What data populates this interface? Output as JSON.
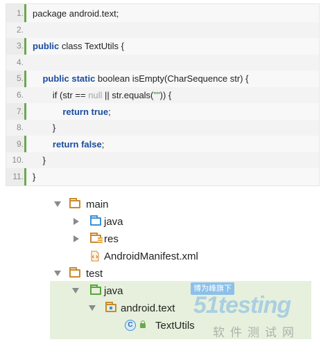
{
  "code": {
    "lines": [
      {
        "num": "1.",
        "segments": [
          {
            "t": "package android.text;",
            "c": ""
          }
        ]
      },
      {
        "num": "2.",
        "segments": []
      },
      {
        "num": "3.",
        "segments": [
          {
            "t": "public",
            "c": "kw"
          },
          {
            "t": " class TextUtils {",
            "c": ""
          }
        ]
      },
      {
        "num": "4.",
        "segments": []
      },
      {
        "num": "5.",
        "segments": [
          {
            "t": "    ",
            "c": ""
          },
          {
            "t": "public static",
            "c": "kw"
          },
          {
            "t": " boolean isEmpty(CharSequence str) {",
            "c": ""
          }
        ]
      },
      {
        "num": "6.",
        "segments": [
          {
            "t": "        if (str == ",
            "c": ""
          },
          {
            "t": "null",
            "c": "lit"
          },
          {
            "t": " || str.equals(",
            "c": ""
          },
          {
            "t": "\"\"",
            "c": "str"
          },
          {
            "t": ")) {",
            "c": ""
          }
        ]
      },
      {
        "num": "7.",
        "segments": [
          {
            "t": "            ",
            "c": ""
          },
          {
            "t": "return true",
            "c": "kw"
          },
          {
            "t": ";",
            "c": ""
          }
        ]
      },
      {
        "num": "8.",
        "segments": [
          {
            "t": "        }",
            "c": ""
          }
        ]
      },
      {
        "num": "9.",
        "segments": [
          {
            "t": "        ",
            "c": ""
          },
          {
            "t": "return false",
            "c": "kw"
          },
          {
            "t": ";",
            "c": ""
          }
        ]
      },
      {
        "num": "10.",
        "segments": [
          {
            "t": "    }",
            "c": ""
          }
        ]
      },
      {
        "num": "11.",
        "segments": [
          {
            "t": "}",
            "c": ""
          }
        ]
      }
    ]
  },
  "tree": {
    "main": {
      "label": "main",
      "icon": "folder-icon",
      "expanded": true
    },
    "java_main": {
      "label": "java",
      "icon": "source-folder-icon",
      "expanded": false
    },
    "res": {
      "label": "res",
      "icon": "resource-folder-icon",
      "expanded": false
    },
    "manifest": {
      "label": "AndroidManifest.xml",
      "icon": "xml-file-icon"
    },
    "test": {
      "label": "test",
      "icon": "folder-icon",
      "expanded": true
    },
    "java_test": {
      "label": "java",
      "icon": "test-source-folder-icon",
      "expanded": true
    },
    "pkg": {
      "label": "android.text",
      "icon": "package-icon",
      "expanded": true
    },
    "cls": {
      "label": "TextUtils",
      "icon": "class-icon",
      "icon_letter": "C"
    }
  },
  "watermark": {
    "badge": "博为峰旗下",
    "brand": "51testing",
    "sub": "软件测试网"
  },
  "colors": {
    "keyword": "#1a4b9e",
    "gutter_border": "#6aa84f",
    "selection": "#e6f0dc",
    "folder": "#c88a2d",
    "source_folder": "#3d8fd6",
    "test_folder": "#5aa33c"
  }
}
